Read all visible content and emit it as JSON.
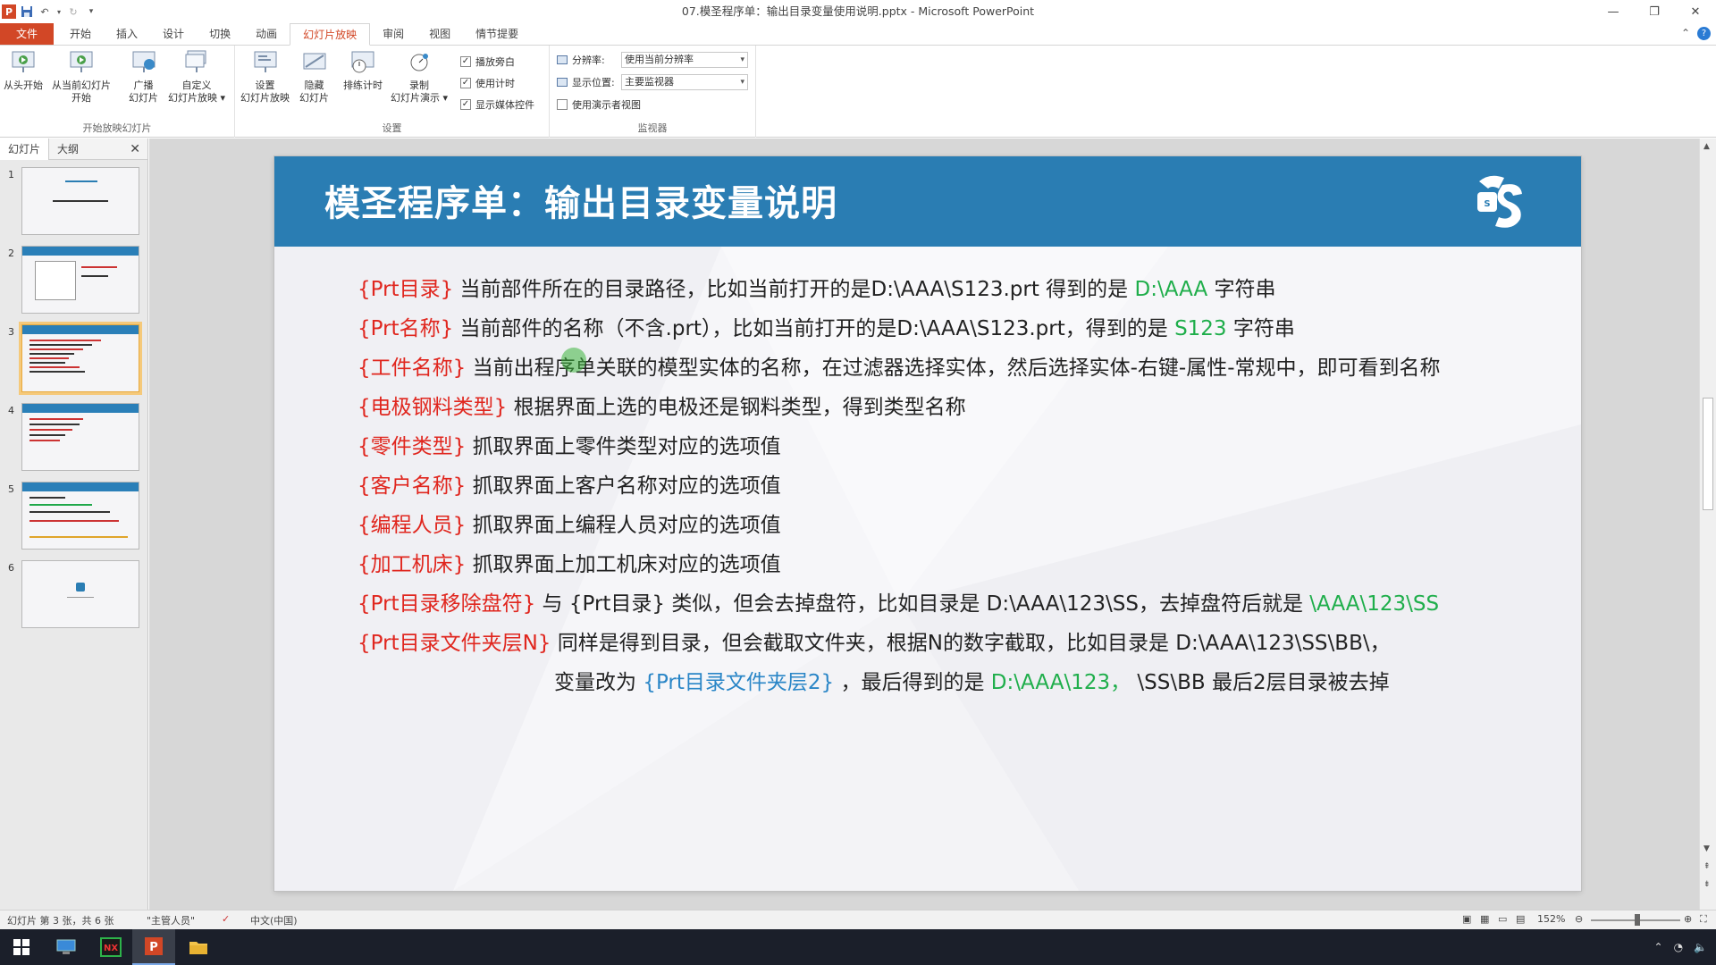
{
  "window": {
    "title": "07.模圣程序单：输出目录变量使用说明.pptx - Microsoft PowerPoint",
    "app_icon": "P"
  },
  "ribbon": {
    "tabs": [
      "文件",
      "开始",
      "插入",
      "设计",
      "切换",
      "动画",
      "幻灯片放映",
      "审阅",
      "视图",
      "情节提要"
    ],
    "active_tab": "幻灯片放映",
    "groups": {
      "start": {
        "label": "开始放映幻灯片",
        "from_beginning": "从头开始",
        "from_current_1": "从当前幻灯片",
        "from_current_2": "开始",
        "broadcast_1": "广播",
        "broadcast_2": "幻灯片",
        "custom_1": "自定义",
        "custom_2": "幻灯片放映 ▾"
      },
      "setup": {
        "label": "设置",
        "setup_1": "设置",
        "setup_2": "幻灯片放映",
        "hide_1": "隐藏",
        "hide_2": "幻灯片",
        "rehearse": "排练计时",
        "record_1": "录制",
        "record_2": "幻灯片演示 ▾",
        "play_narration": "播放旁白",
        "use_timings": "使用计时",
        "show_media": "显示媒体控件"
      },
      "monitors": {
        "label": "监视器",
        "resolution_label": "分辨率:",
        "resolution_value": "使用当前分辨率",
        "show_on_label": "显示位置:",
        "show_on_value": "主要监视器",
        "presenter_view": "使用演示者视图"
      }
    }
  },
  "left_panel": {
    "tabs": [
      "幻灯片",
      "大纲"
    ],
    "slide_numbers": [
      "1",
      "2",
      "3",
      "4",
      "5",
      "6"
    ],
    "selected": 3
  },
  "slide": {
    "title": "模圣程序单：输出目录变量说明",
    "lines": [
      {
        "tag": "{Prt目录}",
        "text": "当前部件所在的目录路径，比如当前打开的是D:\\AAA\\S123.prt   得到的是 ",
        "hl": "D:\\AAA",
        "tail": " 字符串"
      },
      {
        "tag": "{Prt名称}",
        "text": "当前部件的名称（不含.prt），比如当前打开的是D:\\AAA\\S123.prt，得到的是 ",
        "hl": "S123",
        "tail": " 字符串"
      },
      {
        "tag": "{工件名称}",
        "text": "当前出程序单关联的模型实体的名称，在过滤器选择实体，然后选择实体-右键-属性-常规中，即可看到名称",
        "hl": "",
        "tail": ""
      },
      {
        "tag": "{电极钢料类型}",
        "text": "  根据界面上选的电极还是钢料类型，得到类型名称",
        "hl": "",
        "tail": ""
      },
      {
        "tag": "{零件类型}",
        "text": "  抓取界面上零件类型对应的选项值",
        "hl": "",
        "tail": ""
      },
      {
        "tag": "{客户名称}",
        "text": "  抓取界面上客户名称对应的选项值",
        "hl": "",
        "tail": ""
      },
      {
        "tag": "{编程人员}",
        "text": "  抓取界面上编程人员对应的选项值",
        "hl": "",
        "tail": ""
      },
      {
        "tag": "{加工机床}",
        "text": "  抓取界面上加工机床对应的选项值",
        "hl": "",
        "tail": ""
      },
      {
        "tag": "{Prt目录移除盘符}",
        "text": " 与 {Prt目录} 类似，但会去掉盘符，比如目录是  D:\\AAA\\123\\SS，去掉盘符后就是 ",
        "hl": "\\AAA\\123\\SS",
        "tail": ""
      },
      {
        "tag": "{Prt目录文件夹层N}",
        "text": " 同样是得到目录，但会截取文件夹，根据N的数字截取，比如目录是  D:\\AAA\\123\\SS\\BB\\，",
        "hl": "",
        "tail": ""
      }
    ],
    "last_line": {
      "pre": "变量改为 ",
      "var": "{Prt目录文件夹层2}",
      "mid": " ，最后得到的是 ",
      "hl": "D:\\AAA\\123，",
      "tail": "   \\SS\\BB 最后2层目录被去掉"
    }
  },
  "status_bar": {
    "slide_info": "幻灯片 第 3 张，共 6 张",
    "theme": "\"主管人员\"",
    "language": "中文(中国)",
    "zoom": "152%"
  },
  "taskbar": {
    "apps": [
      "start",
      "explorer-app",
      "nx-app",
      "powerpoint-app",
      "folder-app"
    ]
  },
  "colors": {
    "accent": "#d24726",
    "slide_header": "#2a7db3",
    "tag_red": "#e0261e",
    "value_green": "#1fae4b",
    "var_blue": "#2a86c7"
  }
}
